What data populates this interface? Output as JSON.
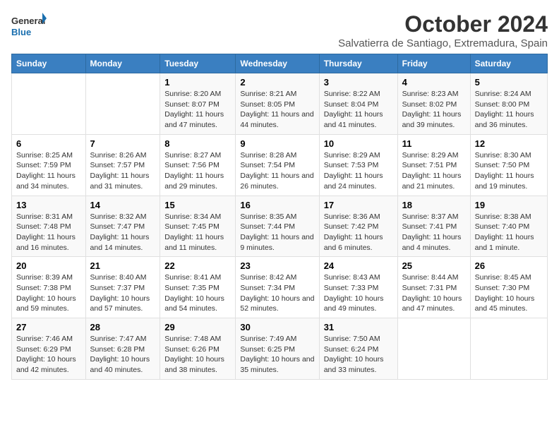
{
  "logo": {
    "text_general": "General",
    "text_blue": "Blue"
  },
  "title": "October 2024",
  "subtitle": "Salvatierra de Santiago, Extremadura, Spain",
  "headers": [
    "Sunday",
    "Monday",
    "Tuesday",
    "Wednesday",
    "Thursday",
    "Friday",
    "Saturday"
  ],
  "weeks": [
    [
      {
        "day": "",
        "sunrise": "",
        "sunset": "",
        "daylight": ""
      },
      {
        "day": "",
        "sunrise": "",
        "sunset": "",
        "daylight": ""
      },
      {
        "day": "1",
        "sunrise": "Sunrise: 8:20 AM",
        "sunset": "Sunset: 8:07 PM",
        "daylight": "Daylight: 11 hours and 47 minutes."
      },
      {
        "day": "2",
        "sunrise": "Sunrise: 8:21 AM",
        "sunset": "Sunset: 8:05 PM",
        "daylight": "Daylight: 11 hours and 44 minutes."
      },
      {
        "day": "3",
        "sunrise": "Sunrise: 8:22 AM",
        "sunset": "Sunset: 8:04 PM",
        "daylight": "Daylight: 11 hours and 41 minutes."
      },
      {
        "day": "4",
        "sunrise": "Sunrise: 8:23 AM",
        "sunset": "Sunset: 8:02 PM",
        "daylight": "Daylight: 11 hours and 39 minutes."
      },
      {
        "day": "5",
        "sunrise": "Sunrise: 8:24 AM",
        "sunset": "Sunset: 8:00 PM",
        "daylight": "Daylight: 11 hours and 36 minutes."
      }
    ],
    [
      {
        "day": "6",
        "sunrise": "Sunrise: 8:25 AM",
        "sunset": "Sunset: 7:59 PM",
        "daylight": "Daylight: 11 hours and 34 minutes."
      },
      {
        "day": "7",
        "sunrise": "Sunrise: 8:26 AM",
        "sunset": "Sunset: 7:57 PM",
        "daylight": "Daylight: 11 hours and 31 minutes."
      },
      {
        "day": "8",
        "sunrise": "Sunrise: 8:27 AM",
        "sunset": "Sunset: 7:56 PM",
        "daylight": "Daylight: 11 hours and 29 minutes."
      },
      {
        "day": "9",
        "sunrise": "Sunrise: 8:28 AM",
        "sunset": "Sunset: 7:54 PM",
        "daylight": "Daylight: 11 hours and 26 minutes."
      },
      {
        "day": "10",
        "sunrise": "Sunrise: 8:29 AM",
        "sunset": "Sunset: 7:53 PM",
        "daylight": "Daylight: 11 hours and 24 minutes."
      },
      {
        "day": "11",
        "sunrise": "Sunrise: 8:29 AM",
        "sunset": "Sunset: 7:51 PM",
        "daylight": "Daylight: 11 hours and 21 minutes."
      },
      {
        "day": "12",
        "sunrise": "Sunrise: 8:30 AM",
        "sunset": "Sunset: 7:50 PM",
        "daylight": "Daylight: 11 hours and 19 minutes."
      }
    ],
    [
      {
        "day": "13",
        "sunrise": "Sunrise: 8:31 AM",
        "sunset": "Sunset: 7:48 PM",
        "daylight": "Daylight: 11 hours and 16 minutes."
      },
      {
        "day": "14",
        "sunrise": "Sunrise: 8:32 AM",
        "sunset": "Sunset: 7:47 PM",
        "daylight": "Daylight: 11 hours and 14 minutes."
      },
      {
        "day": "15",
        "sunrise": "Sunrise: 8:34 AM",
        "sunset": "Sunset: 7:45 PM",
        "daylight": "Daylight: 11 hours and 11 minutes."
      },
      {
        "day": "16",
        "sunrise": "Sunrise: 8:35 AM",
        "sunset": "Sunset: 7:44 PM",
        "daylight": "Daylight: 11 hours and 9 minutes."
      },
      {
        "day": "17",
        "sunrise": "Sunrise: 8:36 AM",
        "sunset": "Sunset: 7:42 PM",
        "daylight": "Daylight: 11 hours and 6 minutes."
      },
      {
        "day": "18",
        "sunrise": "Sunrise: 8:37 AM",
        "sunset": "Sunset: 7:41 PM",
        "daylight": "Daylight: 11 hours and 4 minutes."
      },
      {
        "day": "19",
        "sunrise": "Sunrise: 8:38 AM",
        "sunset": "Sunset: 7:40 PM",
        "daylight": "Daylight: 11 hours and 1 minute."
      }
    ],
    [
      {
        "day": "20",
        "sunrise": "Sunrise: 8:39 AM",
        "sunset": "Sunset: 7:38 PM",
        "daylight": "Daylight: 10 hours and 59 minutes."
      },
      {
        "day": "21",
        "sunrise": "Sunrise: 8:40 AM",
        "sunset": "Sunset: 7:37 PM",
        "daylight": "Daylight: 10 hours and 57 minutes."
      },
      {
        "day": "22",
        "sunrise": "Sunrise: 8:41 AM",
        "sunset": "Sunset: 7:35 PM",
        "daylight": "Daylight: 10 hours and 54 minutes."
      },
      {
        "day": "23",
        "sunrise": "Sunrise: 8:42 AM",
        "sunset": "Sunset: 7:34 PM",
        "daylight": "Daylight: 10 hours and 52 minutes."
      },
      {
        "day": "24",
        "sunrise": "Sunrise: 8:43 AM",
        "sunset": "Sunset: 7:33 PM",
        "daylight": "Daylight: 10 hours and 49 minutes."
      },
      {
        "day": "25",
        "sunrise": "Sunrise: 8:44 AM",
        "sunset": "Sunset: 7:31 PM",
        "daylight": "Daylight: 10 hours and 47 minutes."
      },
      {
        "day": "26",
        "sunrise": "Sunrise: 8:45 AM",
        "sunset": "Sunset: 7:30 PM",
        "daylight": "Daylight: 10 hours and 45 minutes."
      }
    ],
    [
      {
        "day": "27",
        "sunrise": "Sunrise: 7:46 AM",
        "sunset": "Sunset: 6:29 PM",
        "daylight": "Daylight: 10 hours and 42 minutes."
      },
      {
        "day": "28",
        "sunrise": "Sunrise: 7:47 AM",
        "sunset": "Sunset: 6:28 PM",
        "daylight": "Daylight: 10 hours and 40 minutes."
      },
      {
        "day": "29",
        "sunrise": "Sunrise: 7:48 AM",
        "sunset": "Sunset: 6:26 PM",
        "daylight": "Daylight: 10 hours and 38 minutes."
      },
      {
        "day": "30",
        "sunrise": "Sunrise: 7:49 AM",
        "sunset": "Sunset: 6:25 PM",
        "daylight": "Daylight: 10 hours and 35 minutes."
      },
      {
        "day": "31",
        "sunrise": "Sunrise: 7:50 AM",
        "sunset": "Sunset: 6:24 PM",
        "daylight": "Daylight: 10 hours and 33 minutes."
      },
      {
        "day": "",
        "sunrise": "",
        "sunset": "",
        "daylight": ""
      },
      {
        "day": "",
        "sunrise": "",
        "sunset": "",
        "daylight": ""
      }
    ]
  ]
}
